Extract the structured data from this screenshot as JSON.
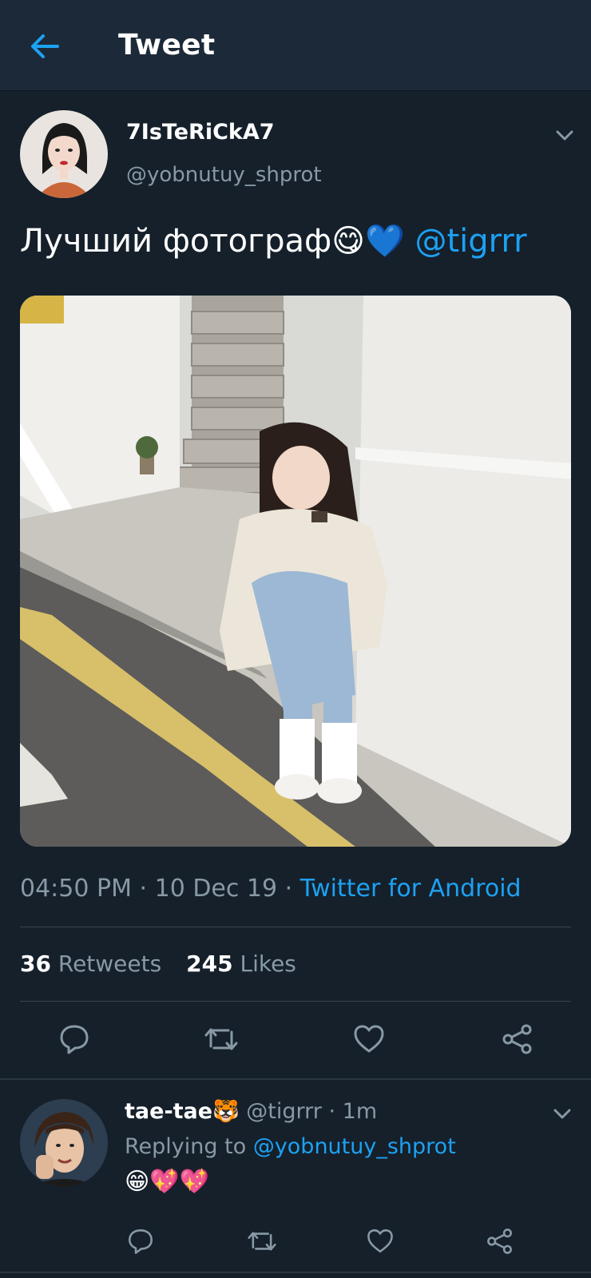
{
  "header": {
    "title": "Tweet"
  },
  "tweet": {
    "author_name": "7IsTeRiCkA7",
    "author_handle": "@yobnutuy_shprot",
    "text": "Лучший фотограф😋💙",
    "mention": "@tigrrr",
    "time": "04:50 PM",
    "date": "10 Dec 19",
    "separator": "·",
    "source": "Twitter for Android",
    "retweets_count": "36",
    "retweets_label": "Retweets",
    "likes_count": "245",
    "likes_label": "Likes"
  },
  "reply": {
    "author_name": "tae-tae🐯",
    "author_handle": "@tigrrr",
    "separator": "·",
    "time": "1m",
    "replying_label": "Replying to",
    "replying_handle": "@yobnutuy_shprot",
    "text": "😁💖💖"
  },
  "icons": {
    "back": "arrow-left-icon",
    "caret": "chevron-down-icon",
    "reply": "reply-icon",
    "retweet": "retweet-icon",
    "like": "heart-icon",
    "share": "share-icon"
  },
  "colors": {
    "background": "#15202b",
    "header": "#1c2938",
    "accent": "#1da1f2",
    "muted": "#8899a6",
    "divider": "#38444d"
  }
}
